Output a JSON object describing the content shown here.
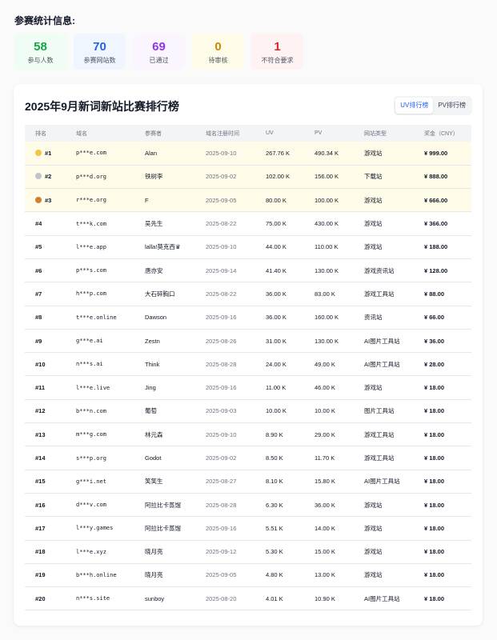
{
  "stats_title": "参赛统计信息:",
  "stats": [
    {
      "value": "58",
      "label": "参与人数",
      "bg": "#f0fdf4",
      "color": "#16a34a"
    },
    {
      "value": "70",
      "label": "参赛网站数",
      "bg": "#eff6ff",
      "color": "#2563eb"
    },
    {
      "value": "69",
      "label": "已通过",
      "bg": "#faf5ff",
      "color": "#9333ea"
    },
    {
      "value": "0",
      "label": "待审核",
      "bg": "#fefce8",
      "color": "#ca8a04"
    },
    {
      "value": "1",
      "label": "不符合要求",
      "bg": "#fef2f2",
      "color": "#dc2626"
    }
  ],
  "card_title": "2025年9月新词新站比赛排行榜",
  "tabs": [
    {
      "label": "UV排行榜",
      "active": true
    },
    {
      "label": "PV排行榜",
      "active": false
    }
  ],
  "columns": [
    "排名",
    "域名",
    "参赛者",
    "域名注册时间",
    "UV",
    "PV",
    "网站类型",
    "奖金（CNY）"
  ],
  "medal_colors": [
    "#f5c542",
    "#c0c4cc",
    "#cd7f32"
  ],
  "rows": [
    {
      "rank": "#1",
      "domain": "p***e.com",
      "user": "Alan",
      "date": "2025-09-10",
      "uv": "267.76 K",
      "pv": "490.34 K",
      "type": "游戏站",
      "prize": "¥ 999.00"
    },
    {
      "rank": "#2",
      "domain": "p***d.org",
      "user": "铁树李",
      "date": "2025-09-02",
      "uv": "102.00 K",
      "pv": "156.00 K",
      "type": "下载站",
      "prize": "¥ 888.00"
    },
    {
      "rank": "#3",
      "domain": "r***e.org",
      "user": "F",
      "date": "2025-09-05",
      "uv": "80.00 K",
      "pv": "100.00 K",
      "type": "游戏站",
      "prize": "¥ 666.00"
    },
    {
      "rank": "#4",
      "domain": "t***k.com",
      "user": "吴先生",
      "date": "2025-08-22",
      "uv": "75.00 K",
      "pv": "430.00 K",
      "type": "游戏站",
      "prize": "¥ 366.00"
    },
    {
      "rank": "#5",
      "domain": "l***e.app",
      "user": "lalla!莫克西♛",
      "date": "2025-09-10",
      "uv": "44.00 K",
      "pv": "110.00 K",
      "type": "游戏站",
      "prize": "¥ 188.00"
    },
    {
      "rank": "#6",
      "domain": "p***s.com",
      "user": "唐亦安",
      "date": "2025-09-14",
      "uv": "41.40 K",
      "pv": "130.00 K",
      "type": "游戏资讯站",
      "prize": "¥ 128.00"
    },
    {
      "rank": "#7",
      "domain": "h***p.com",
      "user": "大石碎胸口",
      "date": "2025-08-22",
      "uv": "36.00 K",
      "pv": "83.00 K",
      "type": "游戏工具站",
      "prize": "¥ 88.00"
    },
    {
      "rank": "#8",
      "domain": "t***e.online",
      "user": "Dawson",
      "date": "2025-09-16",
      "uv": "36.00 K",
      "pv": "160.00 K",
      "type": "资讯站",
      "prize": "¥ 66.00"
    },
    {
      "rank": "#9",
      "domain": "g***e.ai",
      "user": "Zestn",
      "date": "2025-08-26",
      "uv": "31.00 K",
      "pv": "130.00 K",
      "type": "AI图片工具站",
      "prize": "¥ 36.00"
    },
    {
      "rank": "#10",
      "domain": "n***s.ai",
      "user": "Think",
      "date": "2025-08-28",
      "uv": "24.00 K",
      "pv": "49.00 K",
      "type": "AI图片工具站",
      "prize": "¥ 28.00"
    },
    {
      "rank": "#11",
      "domain": "l***e.live",
      "user": "Jing",
      "date": "2025-09-16",
      "uv": "11.00 K",
      "pv": "46.00 K",
      "type": "游戏站",
      "prize": "¥ 18.00"
    },
    {
      "rank": "#12",
      "domain": "b***n.com",
      "user": "葡萄",
      "date": "2025-09-03",
      "uv": "10.00 K",
      "pv": "10.00 K",
      "type": "图片工具站",
      "prize": "¥ 18.00"
    },
    {
      "rank": "#13",
      "domain": "m***g.com",
      "user": "林元森",
      "date": "2025-09-10",
      "uv": "8.90 K",
      "pv": "29.00 K",
      "type": "游戏工具站",
      "prize": "¥ 18.00"
    },
    {
      "rank": "#14",
      "domain": "s***p.org",
      "user": "Godot",
      "date": "2025-09-02",
      "uv": "8.50 K",
      "pv": "11.70 K",
      "type": "游戏工具站",
      "prize": "¥ 18.00"
    },
    {
      "rank": "#15",
      "domain": "g***i.net",
      "user": "笑笑生",
      "date": "2025-08-27",
      "uv": "8.10 K",
      "pv": "15.80 K",
      "type": "AI图片工具站",
      "prize": "¥ 18.00"
    },
    {
      "rank": "#16",
      "domain": "d***v.com",
      "user": "阿拉比卡蒸馏",
      "date": "2025-08-28",
      "uv": "6.30 K",
      "pv": "36.00 K",
      "type": "游戏站",
      "prize": "¥ 18.00"
    },
    {
      "rank": "#17",
      "domain": "l***y.games",
      "user": "阿拉比卡蒸馏",
      "date": "2025-09-16",
      "uv": "5.51 K",
      "pv": "14.00 K",
      "type": "游戏站",
      "prize": "¥ 18.00"
    },
    {
      "rank": "#18",
      "domain": "l***e.xyz",
      "user": "晓月亮",
      "date": "2025-09-12",
      "uv": "5.30 K",
      "pv": "15.00 K",
      "type": "游戏站",
      "prize": "¥ 18.00"
    },
    {
      "rank": "#19",
      "domain": "b***h.online",
      "user": "晓月亮",
      "date": "2025-09-05",
      "uv": "4.80 K",
      "pv": "13.00 K",
      "type": "游戏站",
      "prize": "¥ 18.00"
    },
    {
      "rank": "#20",
      "domain": "n***s.site",
      "user": "sunboy",
      "date": "2025-08-20",
      "uv": "4.01 K",
      "pv": "10.90 K",
      "type": "AI图片工具站",
      "prize": "¥ 18.00"
    }
  ]
}
